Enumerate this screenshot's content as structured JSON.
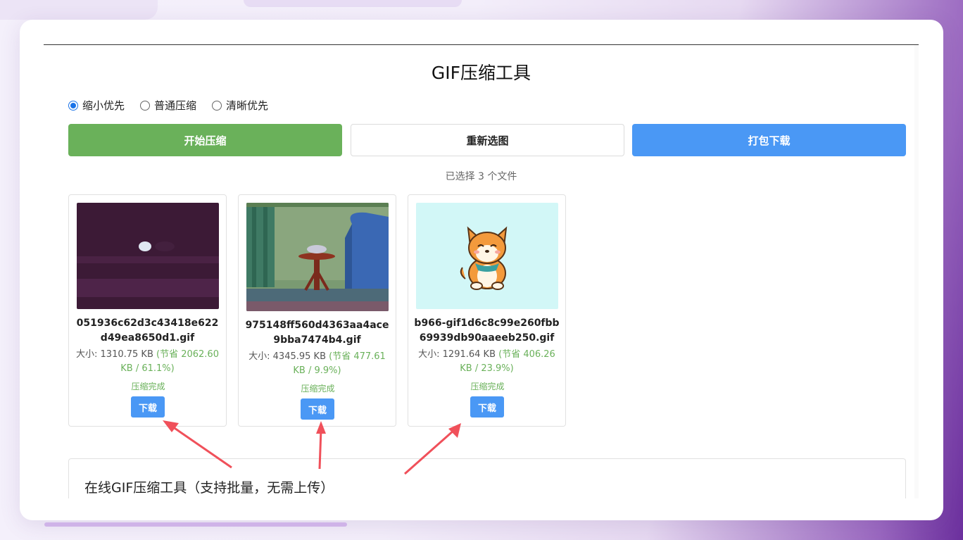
{
  "title": "GIF压缩工具",
  "modes": [
    {
      "label": "缩小优先",
      "checked": true
    },
    {
      "label": "普通压缩",
      "checked": false
    },
    {
      "label": "清晰优先",
      "checked": false
    }
  ],
  "buttons": {
    "start": "开始压缩",
    "reselect": "重新选图",
    "zip": "打包下载"
  },
  "file_count": "已选择 3 个文件",
  "files": [
    {
      "name": "051936c62d3c43418e622d49ea8650d1.gif",
      "size": "大小: 1310.75 KB",
      "saving": "(节省 2062.60 KB / 61.1%)",
      "status": "压缩完成",
      "download": "下载"
    },
    {
      "name": "975148ff560d4363aa4ace9bba7474b4.gif",
      "size": "大小: 4345.95 KB",
      "saving": "(节省 477.61 KB / 9.9%)",
      "status": "压缩完成",
      "download": "下载"
    },
    {
      "name": "b966-gif1d6c8c99e260fbb69939db90aaeeb250.gif",
      "size": "大小: 1291.64 KB",
      "saving": "(节省 406.26 KB / 23.9%)",
      "status": "压缩完成",
      "download": "下载"
    }
  ],
  "info_title": "在线GIF压缩工具（支持批量，无需上传）",
  "colors": {
    "start_button": "#6ab15a",
    "zip_button": "#4a98f5",
    "saving_text": "#6ab15a",
    "annotation_arrow": "#f0505a"
  }
}
